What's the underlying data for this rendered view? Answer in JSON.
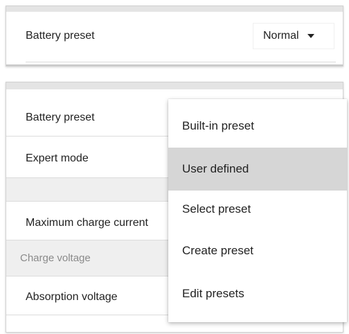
{
  "top_panel": {
    "label": "Battery preset",
    "select_value": "Normal"
  },
  "settings_panel": {
    "rows": [
      {
        "label": "Battery preset"
      },
      {
        "label": "Expert mode"
      },
      {
        "label": "Maximum charge current"
      },
      {
        "label": "Charge voltage"
      },
      {
        "label": "Absorption voltage"
      }
    ]
  },
  "menu": {
    "items": [
      {
        "label": "Built-in preset"
      },
      {
        "label": "User defined"
      },
      {
        "label": "Select preset"
      },
      {
        "label": "Create preset"
      },
      {
        "label": "Edit presets"
      }
    ],
    "selected_index": 1
  },
  "colors": {
    "menu_selected_bg": "#d6d6d6",
    "section_header_bg": "#efefef",
    "section_header_text": "#8a8a8a"
  },
  "icons": {
    "dropdown_caret": "caret-down-icon"
  }
}
